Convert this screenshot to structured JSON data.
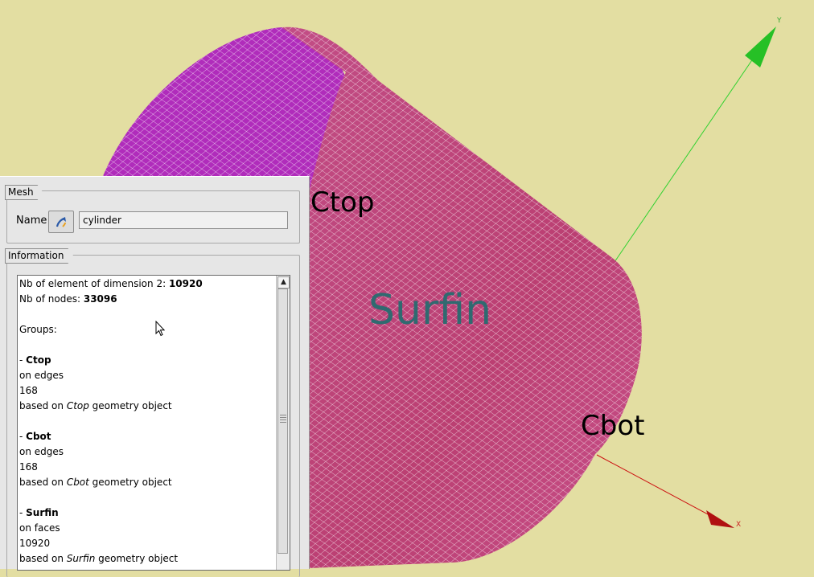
{
  "viewport": {
    "labels": {
      "ctop": "Ctop",
      "cbot": "Cbot",
      "surfin": "Surfin"
    },
    "axes": {
      "y": "Y",
      "x": "X"
    },
    "colors": {
      "background": "#e3dea2",
      "mesh": "#c8457e",
      "cap": "#b82ac0",
      "axis_y": "#2fd12f",
      "axis_x": "#cc1111"
    }
  },
  "panel": {
    "mesh_tab": "Mesh",
    "name_label": "Name",
    "name_value": "cylinder",
    "info_tab": "Information",
    "info_lines": [
      {
        "text": "Nb of element of dimension 2: ",
        "bold": "10920"
      },
      {
        "text": "Nb of nodes: ",
        "bold": "33096"
      },
      {
        "text": ""
      },
      {
        "text": "Groups:"
      },
      {
        "text": ""
      },
      {
        "text": "- ",
        "bold": "Ctop"
      },
      {
        "text": "on edges"
      },
      {
        "text": "168"
      },
      {
        "text": "based on ",
        "italic": "Ctop",
        "suffix": " geometry object"
      },
      {
        "text": ""
      },
      {
        "text": "- ",
        "bold": "Cbot"
      },
      {
        "text": "on edges"
      },
      {
        "text": "168"
      },
      {
        "text": "based on ",
        "italic": "Cbot",
        "suffix": " geometry object"
      },
      {
        "text": ""
      },
      {
        "text": "- ",
        "bold": "Surfin"
      },
      {
        "text": "on faces"
      },
      {
        "text": "10920"
      },
      {
        "text": "based on ",
        "italic": "Surfin",
        "suffix": " geometry object"
      }
    ]
  }
}
